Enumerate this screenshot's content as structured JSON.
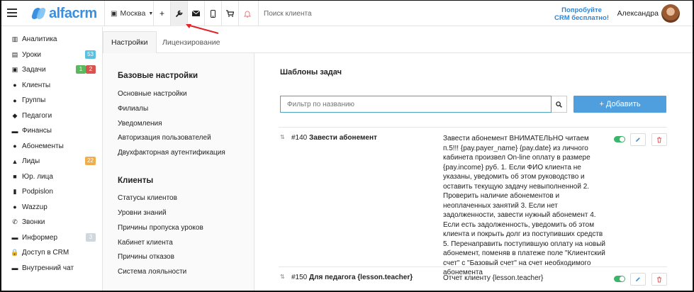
{
  "topbar": {
    "logo": "alfacrm",
    "city": "Москва",
    "search_placeholder": "Поиск клиента",
    "try_line1": "Попробуйте",
    "try_line2": "CRM бесплатно!",
    "user": "Александра",
    "icons": [
      "menu-icon",
      "home-icon",
      "plus-icon",
      "wrench-icon",
      "mail-icon",
      "phone-icon",
      "cart-icon",
      "bell-icon"
    ]
  },
  "sidebar": {
    "items": [
      {
        "label": "Аналитика",
        "icon": "▥"
      },
      {
        "label": "Уроки",
        "icon": "▤",
        "badge": "53",
        "badge_color": "#5bc0de"
      },
      {
        "label": "Задачи",
        "icon": "▣",
        "badge": "1",
        "badge_color": "#5cb85c",
        "badge2": "2",
        "badge2_color": "#d9534f"
      },
      {
        "label": "Клиенты",
        "icon": "●"
      },
      {
        "label": "Группы",
        "icon": "●"
      },
      {
        "label": "Педагоги",
        "icon": "◆"
      },
      {
        "label": "Финансы",
        "icon": "▬"
      },
      {
        "label": "Абонементы",
        "icon": "●"
      },
      {
        "label": "Лиды",
        "icon": "▲",
        "badge": "22",
        "badge_color": "#f0ad4e"
      },
      {
        "label": "Юр. лица",
        "icon": "■"
      },
      {
        "label": "Podpislon",
        "icon": "▮"
      },
      {
        "label": "Wazzup",
        "icon": "●"
      },
      {
        "label": "Звонки",
        "icon": "✆"
      },
      {
        "label": "Информер",
        "icon": "▬",
        "badge": "3",
        "badge_color": "#cfd8dc"
      },
      {
        "label": "Доступ в CRM",
        "icon": "🔒"
      },
      {
        "label": "Внутренний чат",
        "icon": "▬"
      }
    ]
  },
  "tabs": [
    {
      "label": "Настройки",
      "active": true
    },
    {
      "label": "Лицензирование",
      "active": false
    }
  ],
  "settings": {
    "basic_title": "Базовые настройки",
    "basic_links": [
      "Основные настройки",
      "Филиалы",
      "Уведомления",
      "Авторизация пользователей",
      "Двухфакторная аутентификация"
    ],
    "clients_title": "Клиенты",
    "client_links": [
      "Статусы клиентов",
      "Уровни знаний",
      "Причины пропуска уроков",
      "Кабинет клиента",
      "Причины отказов",
      "Система лояльности"
    ]
  },
  "main": {
    "title": "Шаблоны задач",
    "filter_placeholder": "Фильтр по названию",
    "add_label": "+ Добавить",
    "tasks": [
      {
        "id": "#140",
        "name": "Завести абонемент",
        "desc": "Завести абонемент ВНИМАТЕЛЬНО читаем п.5!!! {pay.payer_name} {pay.date} из личного кабинета произвел On-line оплату в размере {pay.income} руб. 1. Если ФИО клиента не указаны, уведомить об этом руководство и оставить текущую задачу невыполненной 2. Проверить наличие абонементов и неоплаченных занятий 3. Если нет задолженности, завести нужный абонемент 4. Если есть задолженность, уведомить об этом клиента и покрыть долг из поступивших средств 5. Перенаправить поступившую оплату на новый абонемент, поменяв в платеже поле \"Клиентский счет\" с \"Базовый счет\" на счет необходимого абонемента",
        "enabled": true
      },
      {
        "id": "#150",
        "name": "Для педагога {lesson.teacher}",
        "desc": "Отчет клиенту {lesson.teacher}",
        "enabled": true
      }
    ]
  },
  "colors": {
    "accent": "#4f9fde",
    "brand": "#3a8fe1",
    "toggle": "#3bb56a",
    "delete": "#e55b5b"
  }
}
